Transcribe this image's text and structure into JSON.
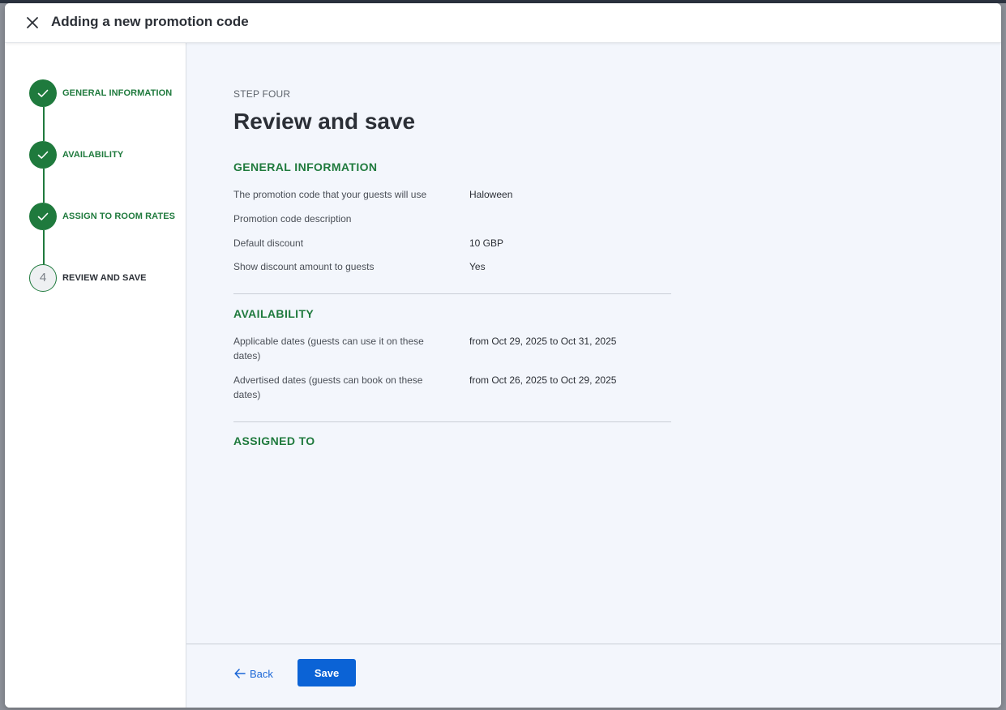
{
  "modal": {
    "title": "Adding a new promotion code",
    "close_icon": "close-icon"
  },
  "steps": [
    {
      "number": "1",
      "label": "GENERAL INFORMATION",
      "state": "completed"
    },
    {
      "number": "2",
      "label": "AVAILABILITY",
      "state": "completed"
    },
    {
      "number": "3",
      "label": "ASSIGN TO ROOM RATES",
      "state": "completed"
    },
    {
      "number": "4",
      "label": "REVIEW AND SAVE",
      "state": "current"
    }
  ],
  "main": {
    "eyebrow": "STEP FOUR",
    "title": "Review and save",
    "general": {
      "title": "GENERAL INFORMATION",
      "rows": [
        {
          "label": "The promotion code that your guests will use",
          "value": "Haloween"
        },
        {
          "label": "Promotion code description",
          "value": ""
        },
        {
          "label": "Default discount",
          "value": "10 GBP"
        },
        {
          "label": "Show discount amount to guests",
          "value": "Yes"
        }
      ]
    },
    "availability": {
      "title": "AVAILABILITY",
      "rows": [
        {
          "label": "Applicable dates (guests can use it on these dates)",
          "value": "from Oct 29, 2025 to Oct 31, 2025"
        },
        {
          "label": "Advertised dates (guests can book on these dates)",
          "value": "from Oct 26, 2025 to Oct 29, 2025"
        }
      ]
    },
    "assigned": {
      "title": "ASSIGNED TO"
    }
  },
  "footer": {
    "back_label": "Back",
    "save_label": "Save"
  },
  "colors": {
    "brand_green": "#1f7a3d",
    "primary_blue": "#0b63d6",
    "link_blue": "#1a66d6"
  }
}
